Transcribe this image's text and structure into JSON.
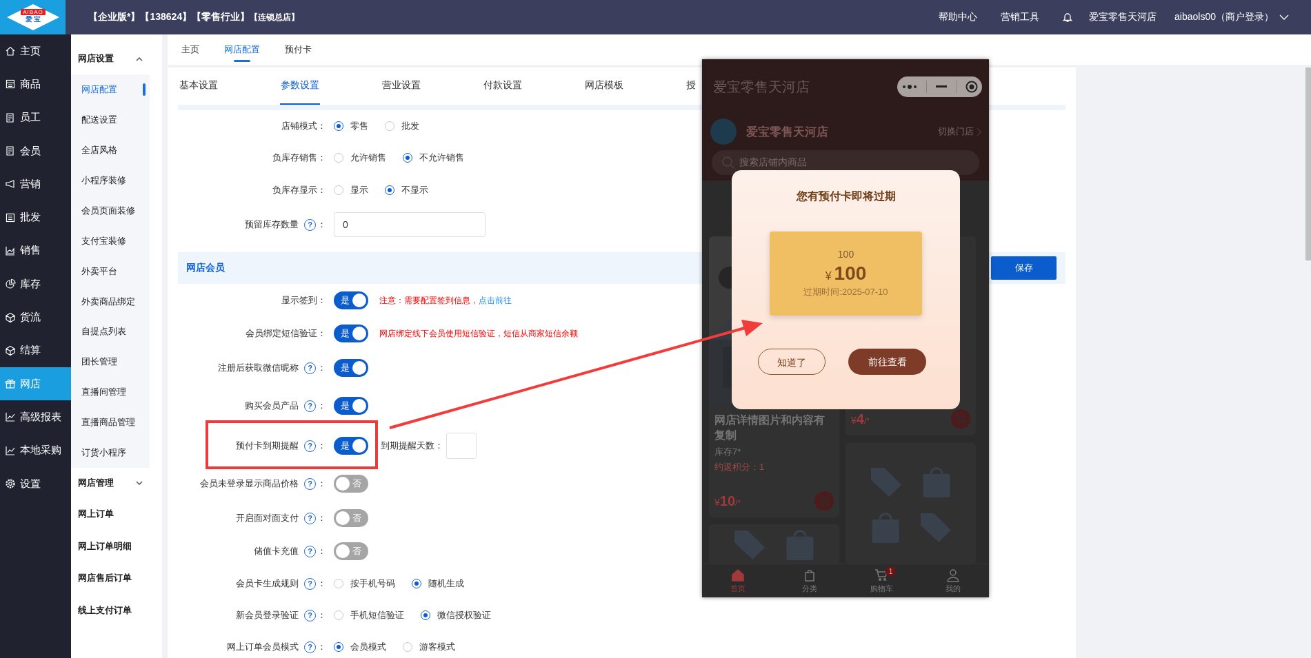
{
  "header": {
    "logo_mark": "AIBAO",
    "logo_name": "爱 宝",
    "edition": "【企业版*】【138624】【零售行业】",
    "branch": "【连锁总店】",
    "links": [
      "帮助中心",
      "营销工具"
    ],
    "store": "爱宝零售天河店",
    "user": "aibaols00（商户登录）"
  },
  "main_nav": [
    {
      "label": "主页",
      "selected": false
    },
    {
      "label": "商品",
      "selected": false
    },
    {
      "label": "员工",
      "selected": false
    },
    {
      "label": "会员",
      "selected": false
    },
    {
      "label": "营销",
      "selected": false
    },
    {
      "label": "批发",
      "selected": false
    },
    {
      "label": "销售",
      "selected": false
    },
    {
      "label": "库存",
      "selected": false
    },
    {
      "label": "货流",
      "selected": false
    },
    {
      "label": "结算",
      "selected": false
    },
    {
      "label": "网店",
      "selected": true
    },
    {
      "label": "高级报表",
      "selected": false
    },
    {
      "label": "本地采购",
      "selected": false
    },
    {
      "label": "设置",
      "selected": false
    }
  ],
  "sub_nav": [
    {
      "kind": "group",
      "label": "网店设置",
      "expanded": true,
      "children": [
        {
          "label": "网店配置",
          "selected": true
        },
        {
          "label": "配送设置",
          "selected": false
        },
        {
          "label": "全店风格",
          "selected": false
        },
        {
          "label": "小程序装修",
          "selected": false
        },
        {
          "label": "会员页面装修",
          "selected": false
        },
        {
          "label": "支付宝装修",
          "selected": false
        },
        {
          "label": "外卖平台",
          "selected": false
        },
        {
          "label": "外卖商品绑定",
          "selected": false
        },
        {
          "label": "自提点列表",
          "selected": false
        },
        {
          "label": "团长管理",
          "selected": false
        },
        {
          "label": "直播间管理",
          "selected": false
        },
        {
          "label": "直播商品管理",
          "selected": false
        },
        {
          "label": "订货小程序",
          "selected": false
        }
      ]
    },
    {
      "kind": "group",
      "label": "网店管理",
      "expanded": false
    },
    {
      "kind": "link",
      "label": "网上订单",
      "selected": false
    },
    {
      "kind": "link",
      "label": "网上订单明细",
      "selected": false
    },
    {
      "kind": "link",
      "label": "网店售后订单",
      "selected": false
    },
    {
      "kind": "link",
      "label": "线上支付订单",
      "selected": false
    }
  ],
  "page_tabs": [
    {
      "label": "主页",
      "selected": false
    },
    {
      "label": "网店配置",
      "selected": true
    },
    {
      "label": "预付卡",
      "selected": false
    }
  ],
  "settings": {
    "tabs": [
      {
        "label": "基本设置",
        "selected": false
      },
      {
        "label": "参数设置",
        "selected": true
      },
      {
        "label": "营业设置",
        "selected": false
      },
      {
        "label": "付款设置",
        "selected": false
      },
      {
        "label": "网店模板",
        "selected": false
      },
      {
        "label": "授",
        "selected": false
      }
    ],
    "rows": [
      {
        "kind": "radio",
        "label": "店铺模式：",
        "options": [
          {
            "label": "零售",
            "selected": true
          },
          {
            "label": "批发",
            "selected": false
          }
        ]
      },
      {
        "kind": "radio",
        "label": "负库存销售：",
        "options": [
          {
            "label": "允许销售",
            "selected": false
          },
          {
            "label": "不允许销售",
            "selected": true
          }
        ]
      },
      {
        "kind": "radio",
        "label": "负库存显示：",
        "options": [
          {
            "label": "显示",
            "selected": false
          },
          {
            "label": "不显示",
            "selected": true
          }
        ]
      },
      {
        "kind": "input",
        "label": "预留库存数量",
        "help": "?",
        "suffix": "：",
        "value": "0"
      }
    ],
    "section": {
      "title": "网店会员",
      "save_button": "保存"
    },
    "member_rows": [
      {
        "kind": "switch",
        "label": "显示签到：",
        "on": true,
        "state_text": "是",
        "highlighted": false,
        "note": "注意：需要配置签到信息，",
        "note_link": "点击前往"
      },
      {
        "kind": "switch",
        "label": "会员绑定短信验证：",
        "on": true,
        "state_text": "是",
        "highlighted": false,
        "note": "网店绑定线下会员使用短信验证，短信从商家短信余额"
      },
      {
        "kind": "switch",
        "label": "注册后获取微信昵称",
        "help": "?",
        "suffix": "：",
        "on": true,
        "state_text": "是",
        "highlighted": false
      },
      {
        "kind": "switch",
        "label": "购买会员产品",
        "help": "?",
        "suffix": "：",
        "on": true,
        "state_text": "是",
        "highlighted": false
      },
      {
        "kind": "switch",
        "label": "预付卡到期提醒",
        "help": "?",
        "suffix": "：",
        "on": true,
        "state_text": "是",
        "highlighted": true,
        "extra_label": "到期提醒天数："
      },
      {
        "kind": "switch",
        "label": "会员未登录显示商品价格",
        "help": "?",
        "suffix": "：",
        "on": false,
        "state_text": "否",
        "highlighted": false
      },
      {
        "kind": "switch",
        "label": "开启面对面支付",
        "help": "?",
        "suffix": "：",
        "on": false,
        "state_text": "否",
        "highlighted": false
      },
      {
        "kind": "switch",
        "label": "储值卡充值",
        "help": "?",
        "suffix": "：",
        "on": false,
        "state_text": "否",
        "highlighted": false
      },
      {
        "kind": "radio",
        "label": "会员卡生成规则",
        "help": "?",
        "suffix": "：",
        "highlighted": false,
        "options": [
          {
            "label": "按手机号码",
            "selected": false
          },
          {
            "label": "随机生成",
            "selected": true
          }
        ]
      },
      {
        "kind": "radio",
        "label": "新会员登录验证",
        "help": "?",
        "suffix": "：",
        "highlighted": false,
        "options": [
          {
            "label": "手机短信验证",
            "selected": false
          },
          {
            "label": "微信授权验证",
            "selected": true
          }
        ]
      },
      {
        "kind": "radio",
        "label": "网上订单会员模式",
        "help": "?",
        "suffix": "：",
        "highlighted": false,
        "options": [
          {
            "label": "会员模式",
            "selected": true
          },
          {
            "label": "游客模式",
            "selected": false
          }
        ]
      }
    ]
  },
  "phone": {
    "title": "爱宝零售天河店",
    "store_name": "爱宝零售天河店",
    "switch_store": "切换门店",
    "search_placeholder": "搜索店铺内商品",
    "products": [
      {
        "name": "网店详情图片和内容有复制",
        "stock": "库存7*",
        "points": "约返积分：1",
        "currency": "¥",
        "price": "10",
        "unit": "/*"
      },
      {
        "currency": "¥",
        "price": "4",
        "unit": "/*"
      }
    ],
    "tabbar": [
      {
        "label": "首页",
        "selected": true
      },
      {
        "label": "分类",
        "selected": false
      },
      {
        "label": "购物车",
        "selected": false,
        "badge": "1"
      },
      {
        "label": "我的",
        "selected": false
      }
    ],
    "modal": {
      "title": "您有预付卡即将过期",
      "card_name": "100",
      "currency": "¥",
      "amount": "100",
      "expiry": "过期时间:2025-07-10",
      "buttons": [
        {
          "label": "知道了",
          "kind": "secondary"
        },
        {
          "label": "前往查看",
          "kind": "primary"
        }
      ]
    }
  }
}
